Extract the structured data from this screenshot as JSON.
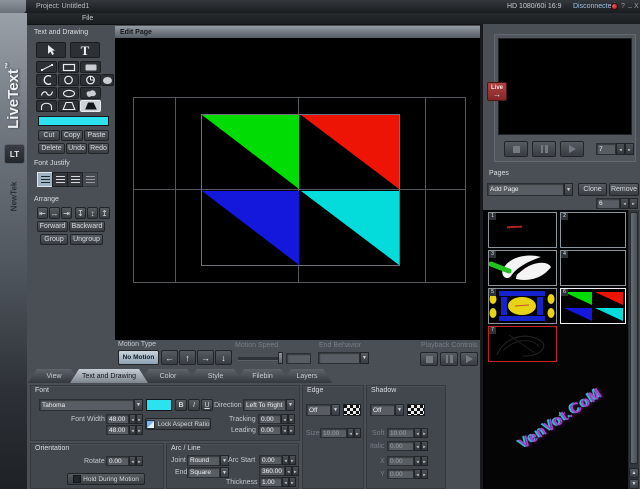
{
  "titlebar": {
    "project": "Project: Untitled1",
    "format": "HD 1080/60i 16:9",
    "connection": "Disconnected",
    "help": "?",
    "minimize": "_",
    "close": "X"
  },
  "menubar": {
    "file": "File"
  },
  "brand": {
    "product": "LiveText",
    "tm": "™",
    "badge": "LT",
    "company": "NewTek"
  },
  "left_panel": {
    "title": "Text and Drawing",
    "text_tool": "T",
    "clipboard": [
      "Cut",
      "Copy",
      "Paste"
    ],
    "editing": [
      "Delete",
      "Undo",
      "Redo"
    ],
    "font_justify_title": "Font Justify",
    "arrange_title": "Arrange",
    "arrange": [
      "Forward",
      "Backward",
      "Group",
      "Ungroup"
    ]
  },
  "canvas": {
    "title": "Edit Page"
  },
  "motion": {
    "type_label": "Motion Type",
    "no_motion": "No Motion",
    "speed_label": "Motion Speed",
    "speed_value": "",
    "end_label": "End Behavior",
    "end_value": "",
    "playback_label": "Playback Controls"
  },
  "tabs": {
    "items": [
      "View",
      "Text and Drawing",
      "Color",
      "Style",
      "Filebin",
      "Layers"
    ]
  },
  "font_panel": {
    "title": "Font",
    "family": "Tahoma",
    "bold": "B",
    "italic": "I",
    "underline": "U",
    "direction_label": "Direction",
    "direction": "Left To Right",
    "width_label": "Font Width",
    "width": "48.00",
    "height": "48.00",
    "lock_label": "Lock Aspect Ratio",
    "tracking_label": "Tracking",
    "tracking": "0.00",
    "leading_label": "Leading",
    "leading": "0.00"
  },
  "orientation_panel": {
    "title": "Orientation",
    "rotate_label": "Rotate",
    "rotate": "0.00",
    "hold_label": "Hold During Motion"
  },
  "arc_panel": {
    "title": "Arc / Line",
    "joint_label": "Joint",
    "joint": "Round",
    "end_label": "End",
    "end": "Square",
    "arc_start_label": "Arc Start",
    "arc_start": "0.00",
    "arc_end": "360.00",
    "thickness_label": "Thickness",
    "thickness": "1.00"
  },
  "edge_panel": {
    "title": "Edge",
    "mode": "Off",
    "size_label": "Size",
    "size": "10.00"
  },
  "shadow_panel": {
    "title": "Shadow",
    "mode": "Off",
    "soft_label": "Soft",
    "soft": "10.00",
    "italic_label": "Italic",
    "italic": "0.00",
    "x_label": "X",
    "x": "0.00",
    "y_label": "Y",
    "y": "0.00"
  },
  "preview": {
    "live": "Live",
    "counter": "7"
  },
  "pages": {
    "title": "Pages",
    "add": "Add Page",
    "clone": "Clone",
    "remove": "Remove",
    "counter": "6",
    "thumbs": [
      {
        "num": "1"
      },
      {
        "num": "2"
      },
      {
        "num": "3"
      },
      {
        "num": "4"
      },
      {
        "num": "5"
      },
      {
        "num": "6"
      },
      {
        "num": "7"
      }
    ]
  },
  "watermark": "VenVot.CoM",
  "glyphs": {
    "dropdown": "▼",
    "spin_left": "◄",
    "spin_right": "►",
    "left": "←",
    "up": "↑",
    "right": "→",
    "down": "↓",
    "align_left": "⇤",
    "align_center_h": "↔",
    "align_right": "⇥",
    "align_bottom": "↧",
    "align_center_v": "↕",
    "align_top": "↥",
    "live_arrow": "→",
    "scroll_up": "▲",
    "scroll_down": "▼"
  },
  "colors": {
    "accent_cyan": "#2be2ee",
    "tri_green": "#00dc04",
    "tri_red": "#ee1405",
    "tri_blue": "#1418dc",
    "tri_cyan": "#04dcdc",
    "live_red": "#a03434",
    "status_red": "#cc2222",
    "watermark_purple": "#a843c9"
  }
}
